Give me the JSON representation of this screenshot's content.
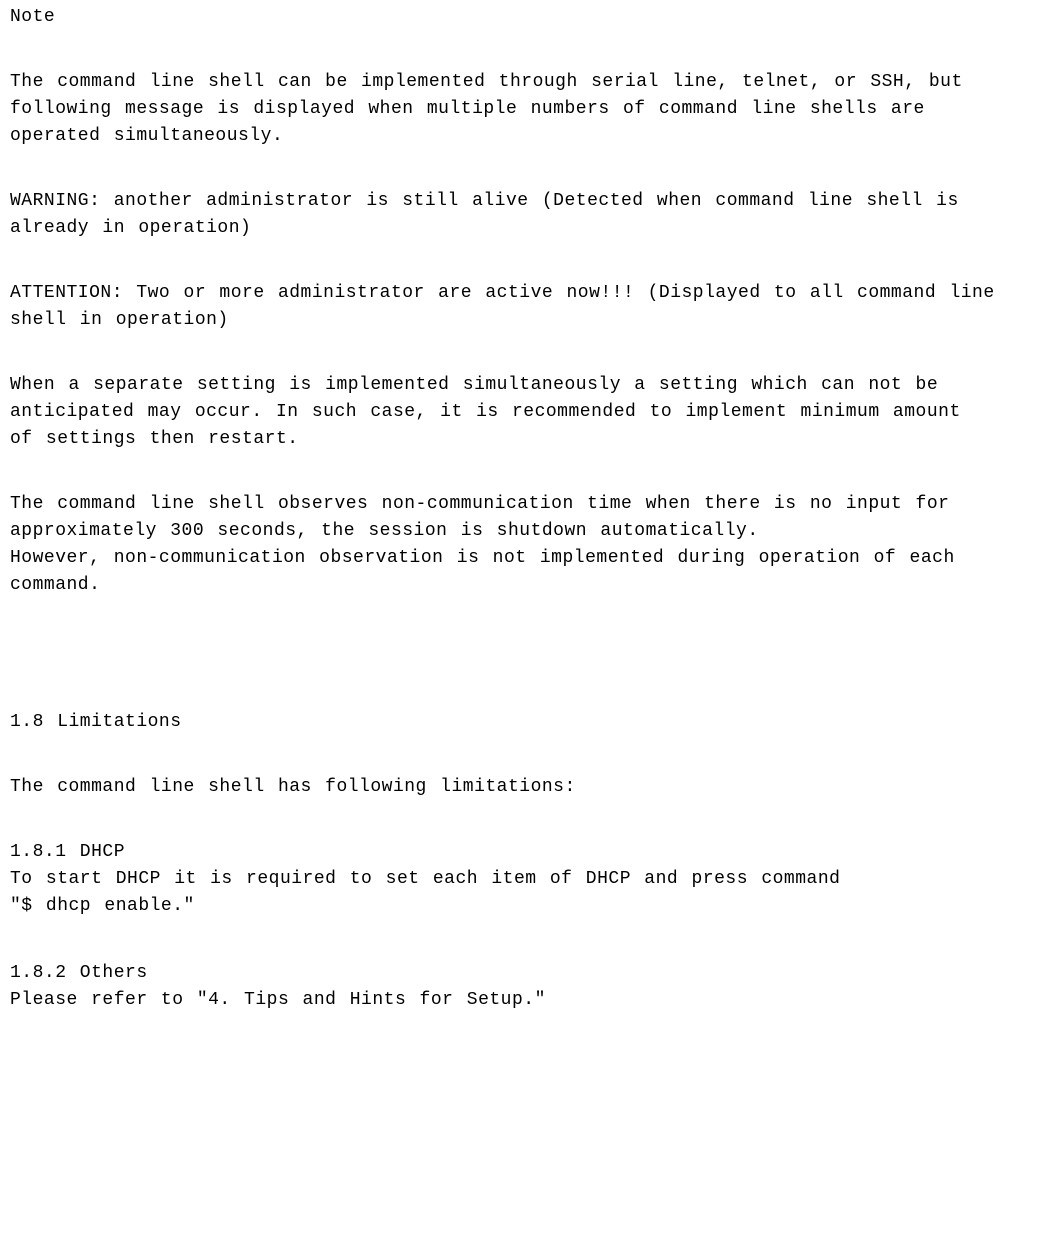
{
  "note_label": "Note",
  "p1_l1": "The command line shell can be implemented through serial line, telnet, or  SSH, but",
  "p1_l2": "following message is displayed when multiple numbers of command line shells are",
  "p1_l3": "operated simultaneously.",
  "p2_l1": "WARNING: another administrator is still alive (Detected when command line shell is",
  "p2_l2": "already in operation)",
  "p3_l1": "ATTENTION: Two or more administrator are active now!!! (Displayed to all command line",
  "p3_l2": "shell in operation)",
  "p4_l1": "When a separate setting is implemented simultaneously a setting which can not be",
  "p4_l2": "anticipated may occur. In such case, it is recommended to implement minimum amount",
  "p4_l3": "of settings then restart.",
  "p5_l1": "The command line shell observes non-communication time when there is no input for",
  "p5_l2": "approximately 300 seconds, the session is shutdown automatically.",
  "p5_l3": "However, non-communication observation is not implemented during operation of each",
  "p5_l4": "command.",
  "sec18_title": "1.8 Limitations",
  "sec18_intro": "The command line shell has following limitations:",
  "sec181_title": "1.8.1  DHCP",
  "sec181_l1": "To start DHCP it is required to set each item of DHCP and press command",
  "sec181_l2": "\"$ dhcp enable.\"",
  "sec182_title": "1.8.2  Others",
  "sec182_l1": "Please refer to \"4. Tips and Hints for Setup.\""
}
